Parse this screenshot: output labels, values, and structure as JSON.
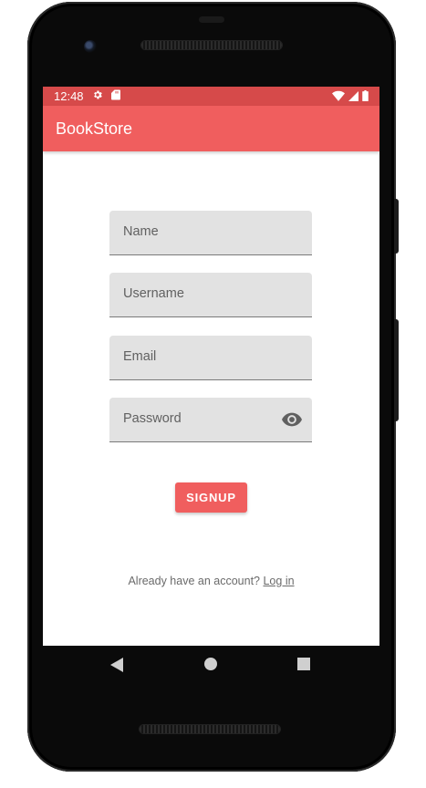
{
  "status_bar": {
    "time": "12:48",
    "left_icons": [
      "gear-icon",
      "sd-card-icon"
    ],
    "right_icons": [
      "wifi-icon",
      "signal-icon",
      "battery-icon"
    ],
    "color": "#d64a4a"
  },
  "app_bar": {
    "title": "BookStore",
    "color": "#f05e5e"
  },
  "form": {
    "name_label": "Name",
    "username_label": "Username",
    "email_label": "Email",
    "password_label": "Password",
    "password_toggle_icon": "eye-icon",
    "field_color": "#e2e2e2"
  },
  "signup_button": {
    "label": "SIGNUP",
    "color": "#f05e5e"
  },
  "account_prompt": {
    "text": "Already have an account?",
    "link_label": "Log in"
  },
  "nav_bar": {
    "icons": [
      "back-triangle-icon",
      "home-circle-icon",
      "recents-square-icon"
    ]
  }
}
